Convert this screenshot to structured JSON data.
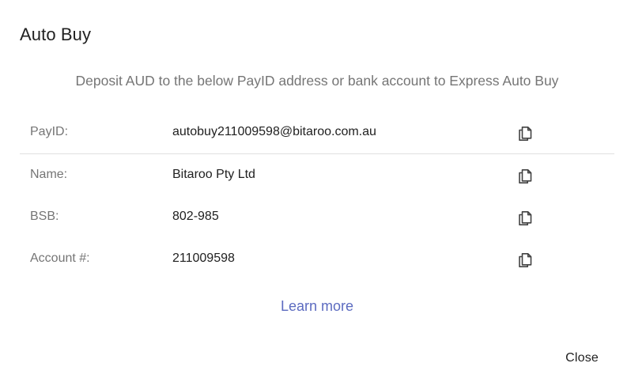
{
  "dialog": {
    "title": "Auto Buy",
    "subtitle": "Deposit AUD to the below PayID address or bank account to Express Auto Buy",
    "rows": [
      {
        "label": "PayID:",
        "value": "autobuy211009598@bitaroo.com.au",
        "icon": "copy-icon"
      },
      {
        "label": "Name:",
        "value": "Bitaroo Pty Ltd",
        "icon": "copy-icon"
      },
      {
        "label": "BSB:",
        "value": "802-985",
        "icon": "copy-icon"
      },
      {
        "label": "Account #:",
        "value": "211009598",
        "icon": "copy-icon"
      }
    ],
    "learn_more": "Learn more",
    "close_label": "Close"
  },
  "colors": {
    "title": "#212121",
    "muted_text": "#757575",
    "link": "#5c6bc0",
    "divider": "#e0e0e0"
  }
}
